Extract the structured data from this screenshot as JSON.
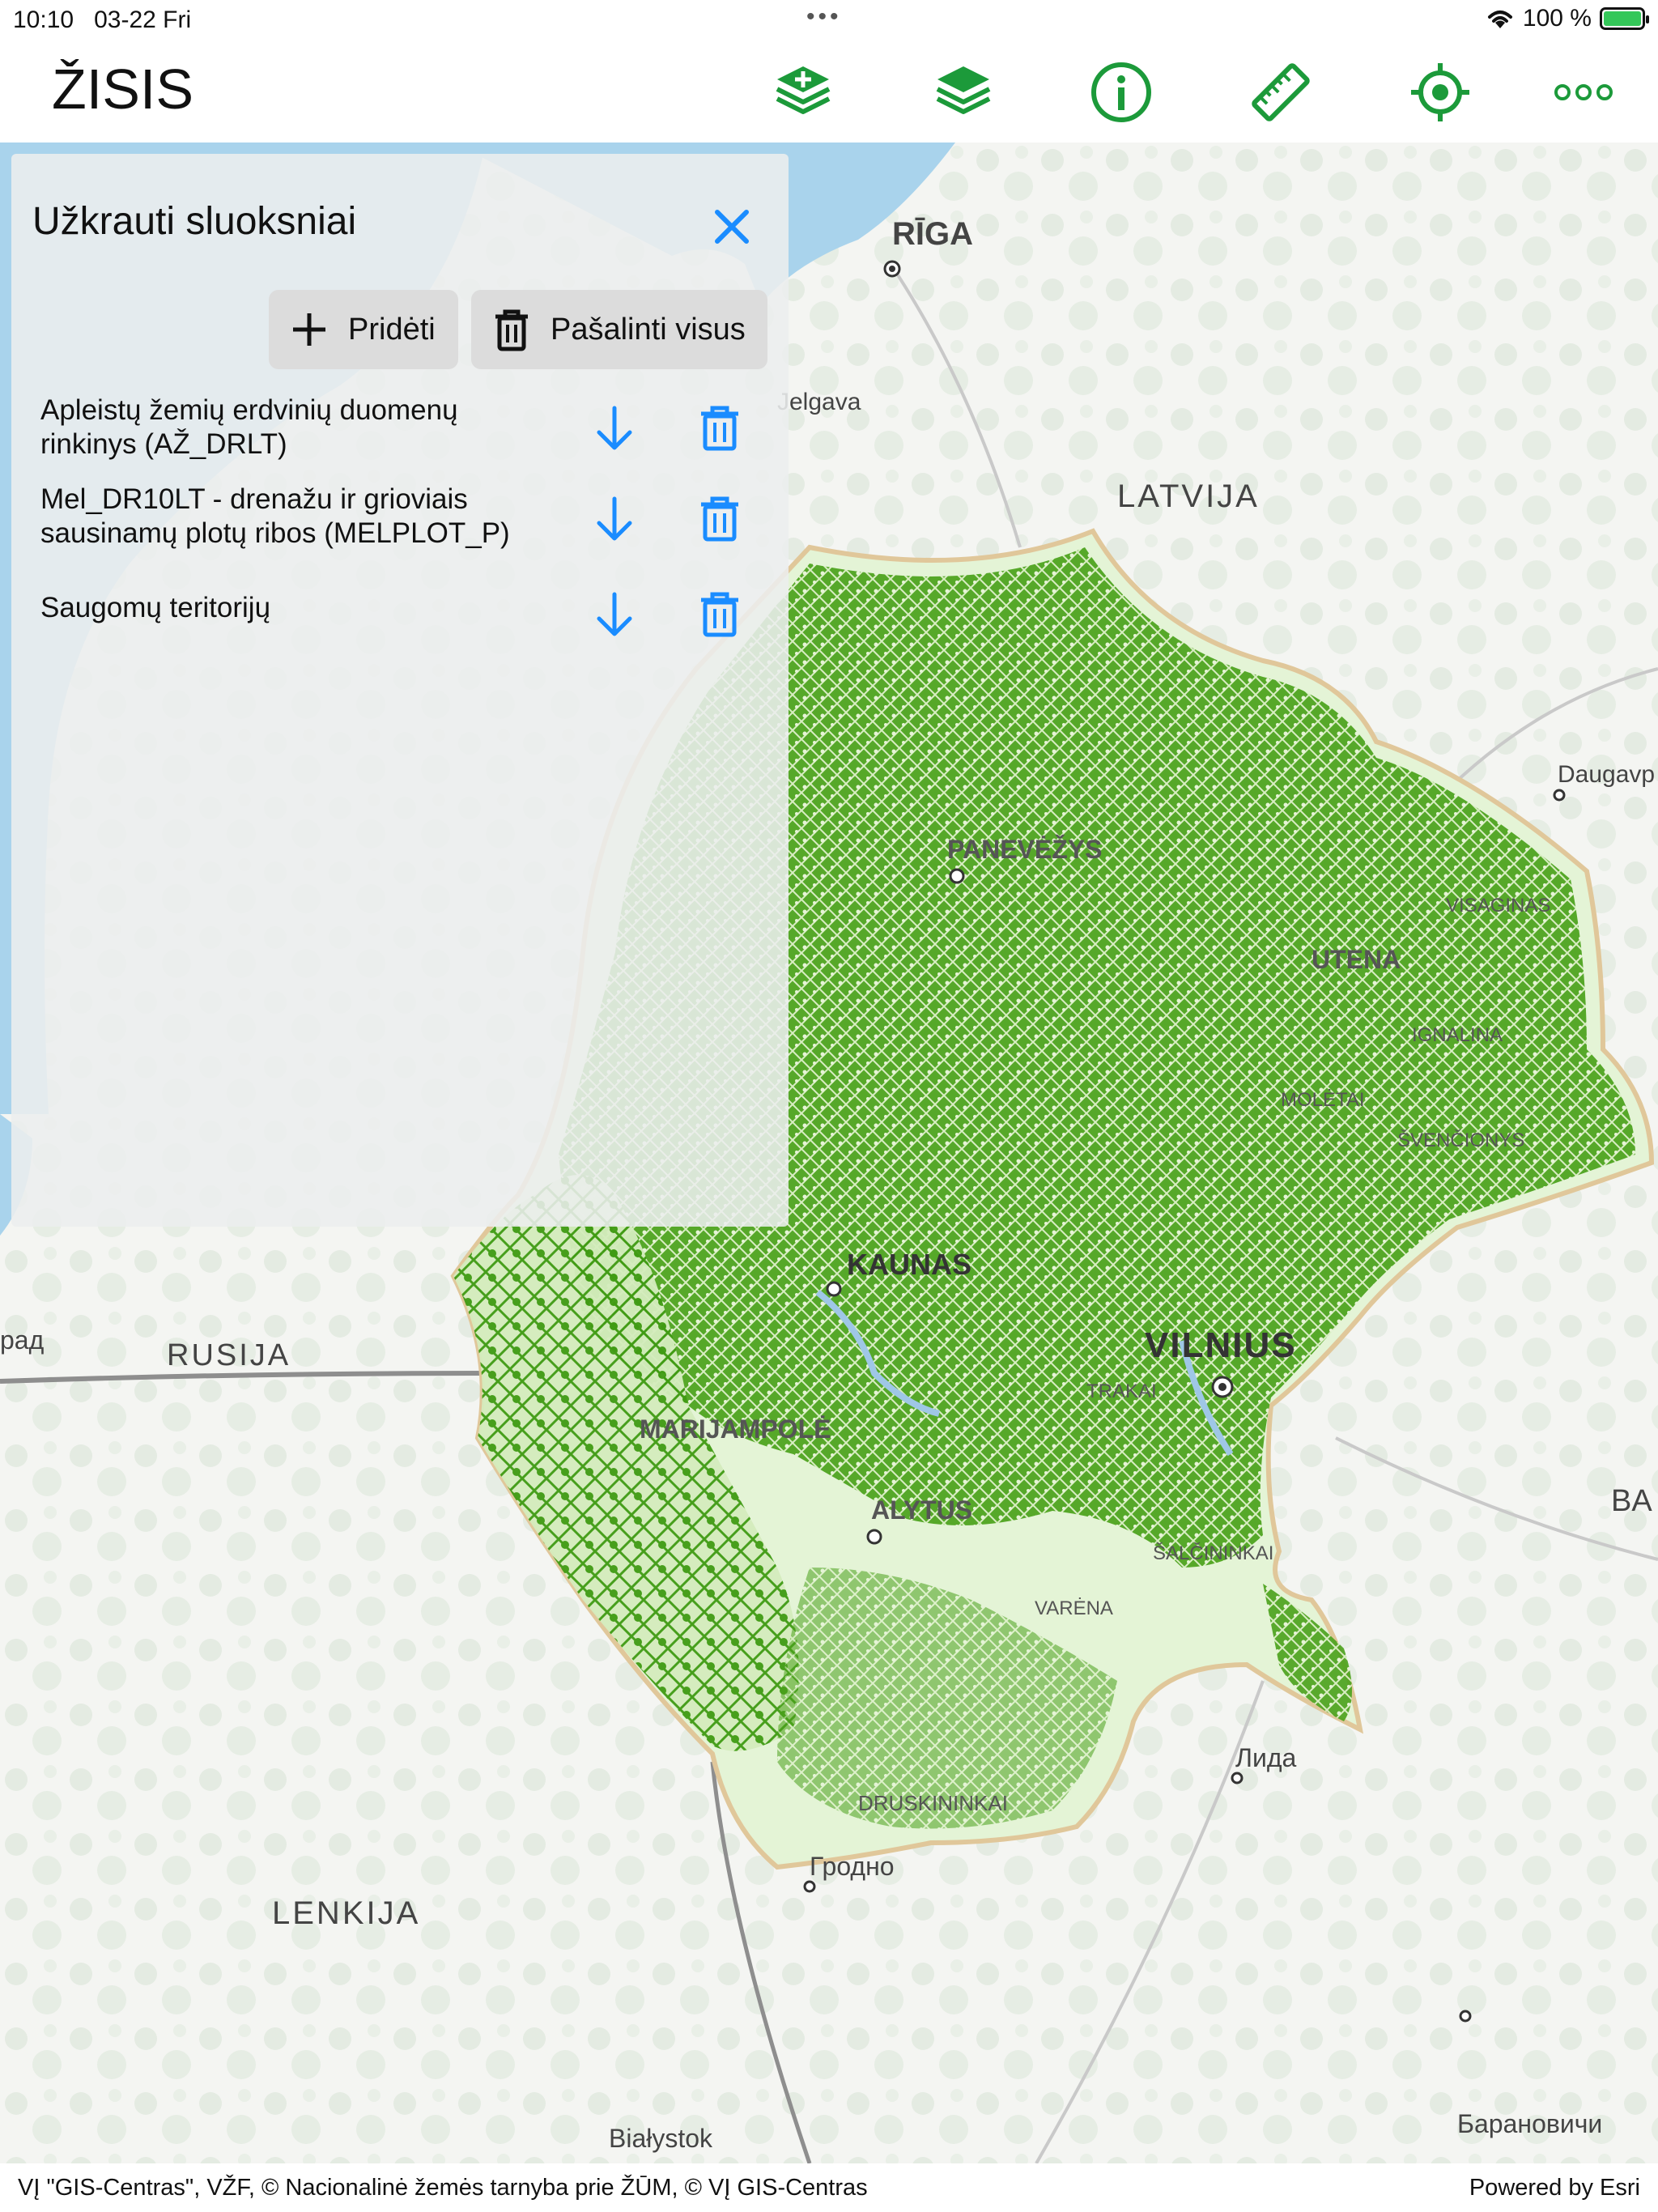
{
  "status_bar": {
    "time": "10:10",
    "date": "03-22 Fri",
    "dots": "•••",
    "battery_text": "100 %"
  },
  "app": {
    "title": "ŽISIS",
    "accent_color": "#1c9a3a",
    "link_color": "#1a8cff",
    "toolbar": [
      {
        "name": "add-layer-icon"
      },
      {
        "name": "layers-icon"
      },
      {
        "name": "info-icon"
      },
      {
        "name": "ruler-icon"
      },
      {
        "name": "locate-icon"
      },
      {
        "name": "more-icon"
      }
    ]
  },
  "panel": {
    "title": "Užkrauti sluoksniai",
    "add_label": "Pridėti",
    "remove_all_label": "Pašalinti visus",
    "layers": [
      {
        "line1": "Apleistų žemių erdvinių duomenų",
        "line2": "rinkinys (AŽ_DRLT)"
      },
      {
        "line1": "Mel_DR10LT - drenažu ir grioviais",
        "line2": "sausinamų plotų ribos (MELPLOT_P)"
      },
      {
        "line1": "Saugomų teritorijų",
        "line2": ""
      }
    ]
  },
  "map": {
    "labels": {
      "riga": "RĪGA",
      "jelgava": "Jelgava",
      "latvija": "LATVIJA",
      "daugavpils": "Daugavp",
      "visaginas": "VISAGINAS",
      "utena": "UTENA",
      "ignalina": "IGNALINA",
      "moletai": "MOLĖTAI",
      "svencionys": "ŠVENČIONYS",
      "panevezys": "PANEVĖŽYS",
      "kaunas": "KAUNAS",
      "vilnius": "VILNIUS",
      "trakai": "TRAKAI",
      "marijampole": "MARIJAMPOLĖ",
      "alytus": "ALYTUS",
      "salcininkai": "ŠALČININKAI",
      "varena": "VARĖNA",
      "druskininkai": "DRUSKININKAI",
      "rusija": "RUSIJA",
      "rad": "рад",
      "ba": "BA",
      "lida": "Лида",
      "grodno": "Гродно",
      "lenkija": "LENKIJA",
      "bialystok": "Białystok",
      "baranovichi": "Барановичи"
    }
  },
  "attribution": {
    "left": "VĮ \"GIS-Centras\", VŽF, © Nacionalinė žemės tarnyba prie ŽŪM, © VĮ GIS-Centras",
    "right": "Powered by Esri"
  }
}
